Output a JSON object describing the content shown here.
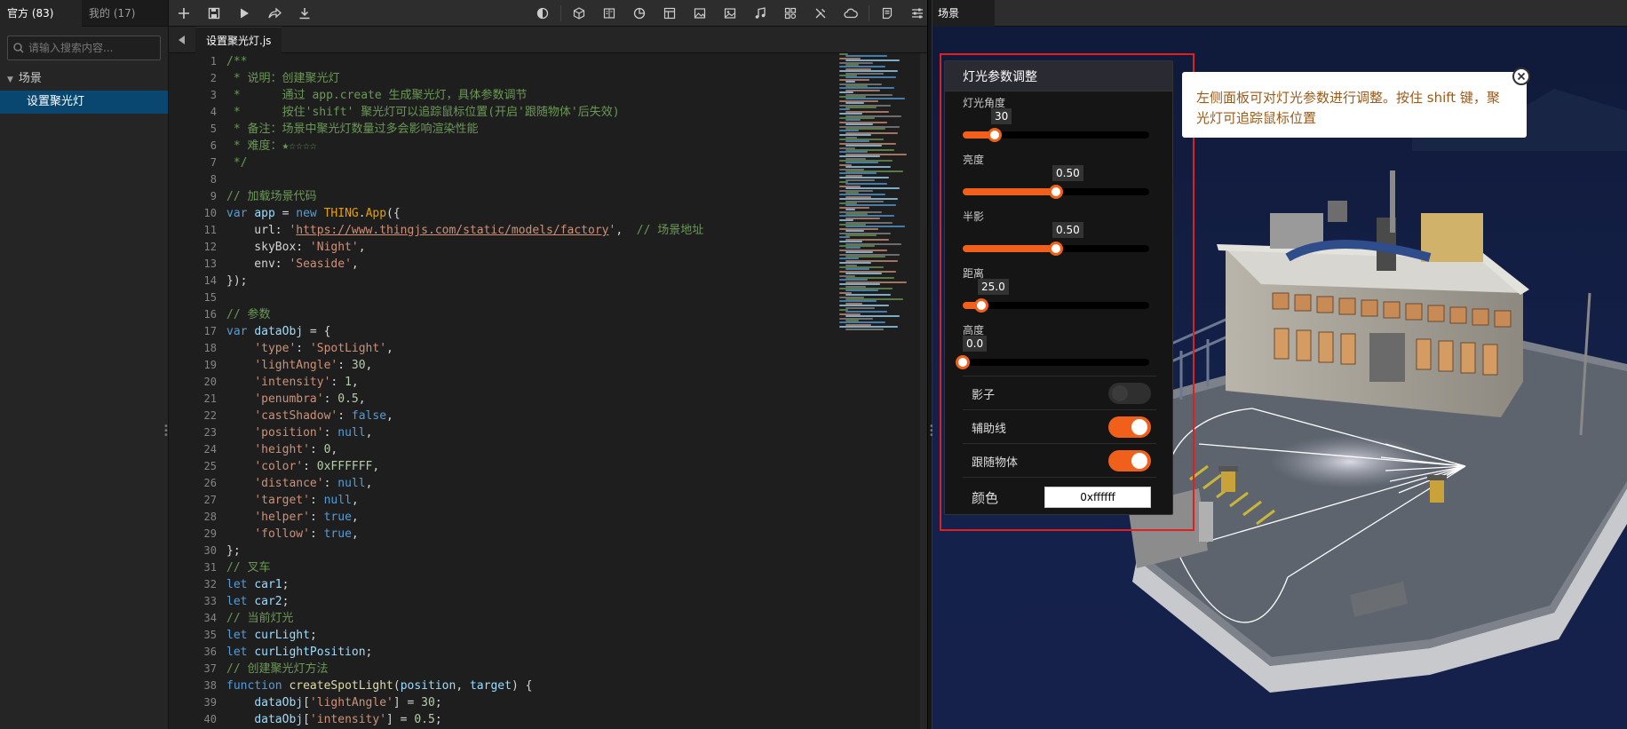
{
  "sidebar": {
    "tabs": [
      {
        "label": "官方 (83)"
      },
      {
        "label": "我的 (17)"
      }
    ],
    "search_placeholder": "请输入搜索内容...",
    "tree": {
      "group": "场景",
      "items": [
        {
          "label": "设置聚光灯"
        }
      ]
    }
  },
  "toolbar": {
    "left_icons": [
      "plus-icon",
      "save-icon",
      "play-icon",
      "share-icon",
      "download-icon"
    ],
    "right_icons": [
      "half-circle-icon",
      "cube-icon",
      "book-icon",
      "pie-icon",
      "layout-icon",
      "image-icon",
      "image-alt-icon",
      "music-icon",
      "grid-icon",
      "tools-icon",
      "cloud-icon",
      "notes-icon",
      "sliders-icon"
    ]
  },
  "editor": {
    "tab_label": "设置聚光灯.js",
    "line_count": 40
  },
  "scene": {
    "tab_label": "场景",
    "panel": {
      "title": "灯光参数调整",
      "sliders": [
        {
          "label": "灯光角度",
          "value": "30",
          "fraction": 0.17
        },
        {
          "label": "亮度",
          "value": "0.50",
          "fraction": 0.5
        },
        {
          "label": "半影",
          "value": "0.50",
          "fraction": 0.5
        },
        {
          "label": "距离",
          "value": "25.0",
          "fraction": 0.1
        },
        {
          "label": "高度",
          "value": "0.0",
          "fraction": 0.0
        }
      ],
      "toggles": [
        {
          "label": "影子",
          "on": false
        },
        {
          "label": "辅助线",
          "on": true
        },
        {
          "label": "跟随物体",
          "on": true
        }
      ],
      "color_label": "颜色",
      "color_value": "0xffffff"
    },
    "tooltip": "左侧面板可对灯光参数进行调整。按住 shift 键，聚光灯可追踪鼠标位置"
  },
  "colors": {
    "accent": "#f1601a",
    "highlight": "#e02020",
    "selection": "#094771"
  }
}
